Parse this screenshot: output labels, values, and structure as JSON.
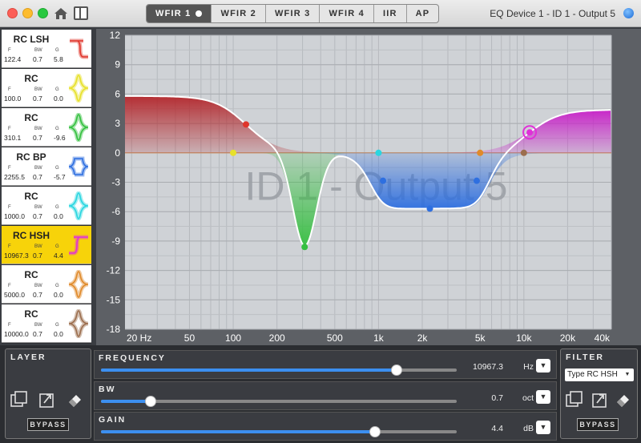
{
  "window": {
    "title": "EQ Device 1 - ID 1 - Output 5",
    "tabs": [
      {
        "label": "WFIR 1",
        "active": true
      },
      {
        "label": "WFIR 2",
        "active": false
      },
      {
        "label": "WFIR 3",
        "active": false
      },
      {
        "label": "WFIR 4",
        "active": false
      },
      {
        "label": "IIR",
        "active": false
      },
      {
        "label": "AP",
        "active": false
      }
    ]
  },
  "band_headers": {
    "f": "F",
    "bw": "BW",
    "g": "G"
  },
  "bands": [
    {
      "name": "RC LSH",
      "f": "122.4",
      "bw": "0.7",
      "g": "5.8",
      "color": "#e0352b",
      "shape": "lsh",
      "selected": false
    },
    {
      "name": "RC",
      "f": "100.0",
      "bw": "0.7",
      "g": "0.0",
      "color": "#e7e12a",
      "shape": "pk",
      "selected": false
    },
    {
      "name": "RC",
      "f": "310.1",
      "bw": "0.7",
      "g": "-9.6",
      "color": "#35c040",
      "shape": "pk",
      "selected": false
    },
    {
      "name": "RC BP",
      "f": "2255.5",
      "bw": "0.7",
      "g": "-5.7",
      "color": "#2e6fe0",
      "shape": "bp",
      "selected": false
    },
    {
      "name": "RC",
      "f": "1000.0",
      "bw": "0.7",
      "g": "0.0",
      "color": "#2ad6e0",
      "shape": "pk",
      "selected": false
    },
    {
      "name": "RC HSH",
      "f": "10967.3",
      "bw": "0.7",
      "g": "4.4",
      "color": "#e030d8",
      "shape": "hsh",
      "selected": true
    },
    {
      "name": "RC",
      "f": "5000.0",
      "bw": "0.7",
      "g": "0.0",
      "color": "#e08a2a",
      "shape": "pk",
      "selected": false
    },
    {
      "name": "RC",
      "f": "10000.0",
      "bw": "0.7",
      "g": "0.0",
      "color": "#9c6e4e",
      "shape": "pk",
      "selected": false
    }
  ],
  "graph": {
    "watermark": "ID 1 - Output 5",
    "y_ticks": [
      "12",
      "9",
      "6",
      "3",
      "0",
      "-3",
      "-6",
      "-9",
      "-12",
      "-15",
      "-18"
    ],
    "x_ticks": [
      {
        "label": "20 Hz",
        "f": 20
      },
      {
        "label": "50",
        "f": 50
      },
      {
        "label": "100",
        "f": 100
      },
      {
        "label": "200",
        "f": 200
      },
      {
        "label": "500",
        "f": 500
      },
      {
        "label": "1k",
        "f": 1000
      },
      {
        "label": "2k",
        "f": 2000
      },
      {
        "label": "5k",
        "f": 5000
      },
      {
        "label": "10k",
        "f": 10000
      },
      {
        "label": "20k",
        "f": 20000
      },
      {
        "label": "40k",
        "f": 40000
      }
    ],
    "x_range_hz": [
      18,
      40000
    ],
    "y_range_db": [
      -18,
      12
    ],
    "log_x": true,
    "grid": true
  },
  "layer": {
    "title": "LAYER",
    "bypass": "BYPASS"
  },
  "filter": {
    "title": "FILTER",
    "type_label": "Type RC HSH",
    "bypass": "BYPASS"
  },
  "params": {
    "frequency": {
      "label": "FREQUENCY",
      "value": "10967.3",
      "unit": "Hz",
      "fraction": 0.83
    },
    "bw": {
      "label": "BW",
      "value": "0.7",
      "unit": "oct",
      "fraction": 0.14
    },
    "gain": {
      "label": "GAIN",
      "value": "4.4",
      "unit": "dB",
      "fraction": 0.77
    }
  }
}
